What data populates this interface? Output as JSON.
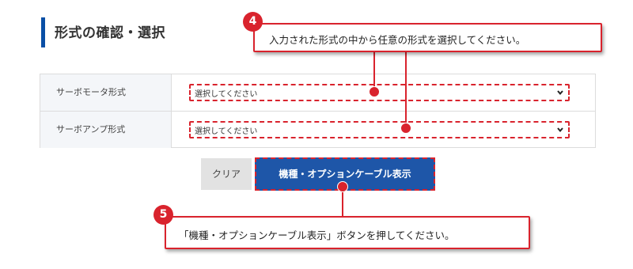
{
  "section": {
    "title": "形式の確認・選択"
  },
  "form": {
    "rows": [
      {
        "label": "サーボモータ形式",
        "select_value": "選択してください"
      },
      {
        "label": "サーボアンプ形式",
        "select_value": "選択してください"
      }
    ]
  },
  "buttons": {
    "clear_label": "クリア",
    "show_label": "機種・オプションケーブル表示"
  },
  "callouts": [
    {
      "number": "4",
      "text": "入力された形式の中から任意の形式を選択してください。"
    },
    {
      "number": "5",
      "text": "「機種・オプションケーブル表示」ボタンを押してください。"
    }
  ],
  "colors": {
    "accent_blue": "#1e56a8",
    "annotation_red": "#d9232d",
    "label_background": "#f4f6f9"
  }
}
